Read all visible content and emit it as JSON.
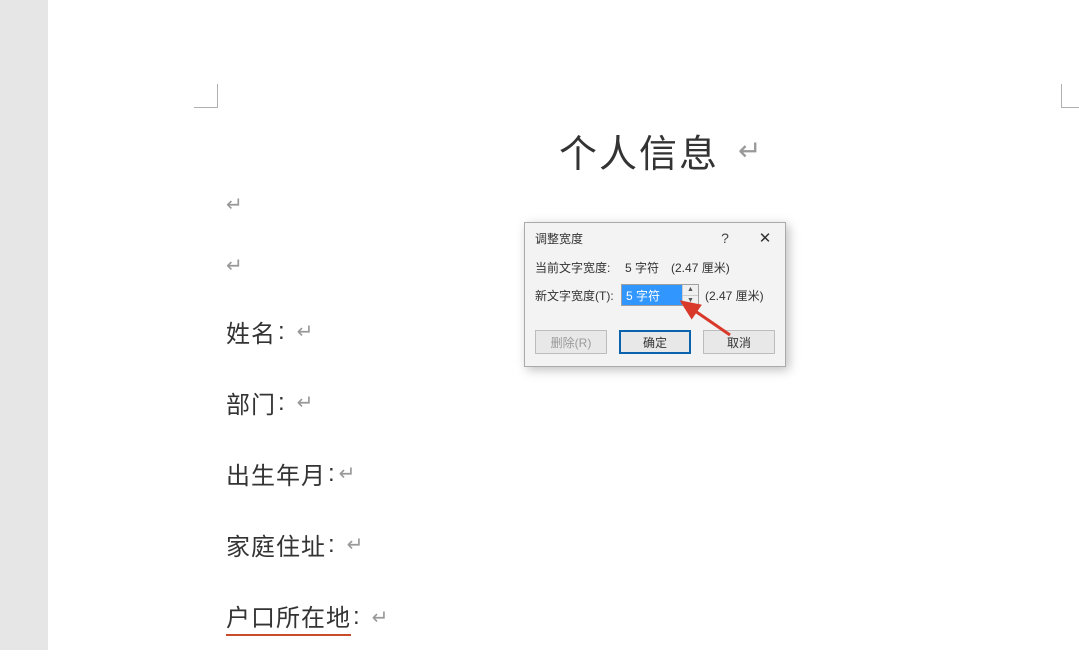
{
  "document": {
    "title": "个人信息",
    "fields": [
      {
        "label": "姓名"
      },
      {
        "label": "部门"
      },
      {
        "label": "出生年月"
      },
      {
        "label": "家庭住址"
      },
      {
        "label": "户口所在地",
        "underlined": true
      }
    ]
  },
  "dialog": {
    "title": "调整宽度",
    "current_label": "当前文字宽度:",
    "current_value": "5 字符",
    "current_cm": "(2.47 厘米)",
    "new_label": "新文字宽度(T):",
    "new_value": "5 字符",
    "new_cm": "(2.47 厘米)",
    "buttons": {
      "delete": "删除(R)",
      "ok": "确定",
      "cancel": "取消"
    },
    "help": "?",
    "close": "✕"
  }
}
